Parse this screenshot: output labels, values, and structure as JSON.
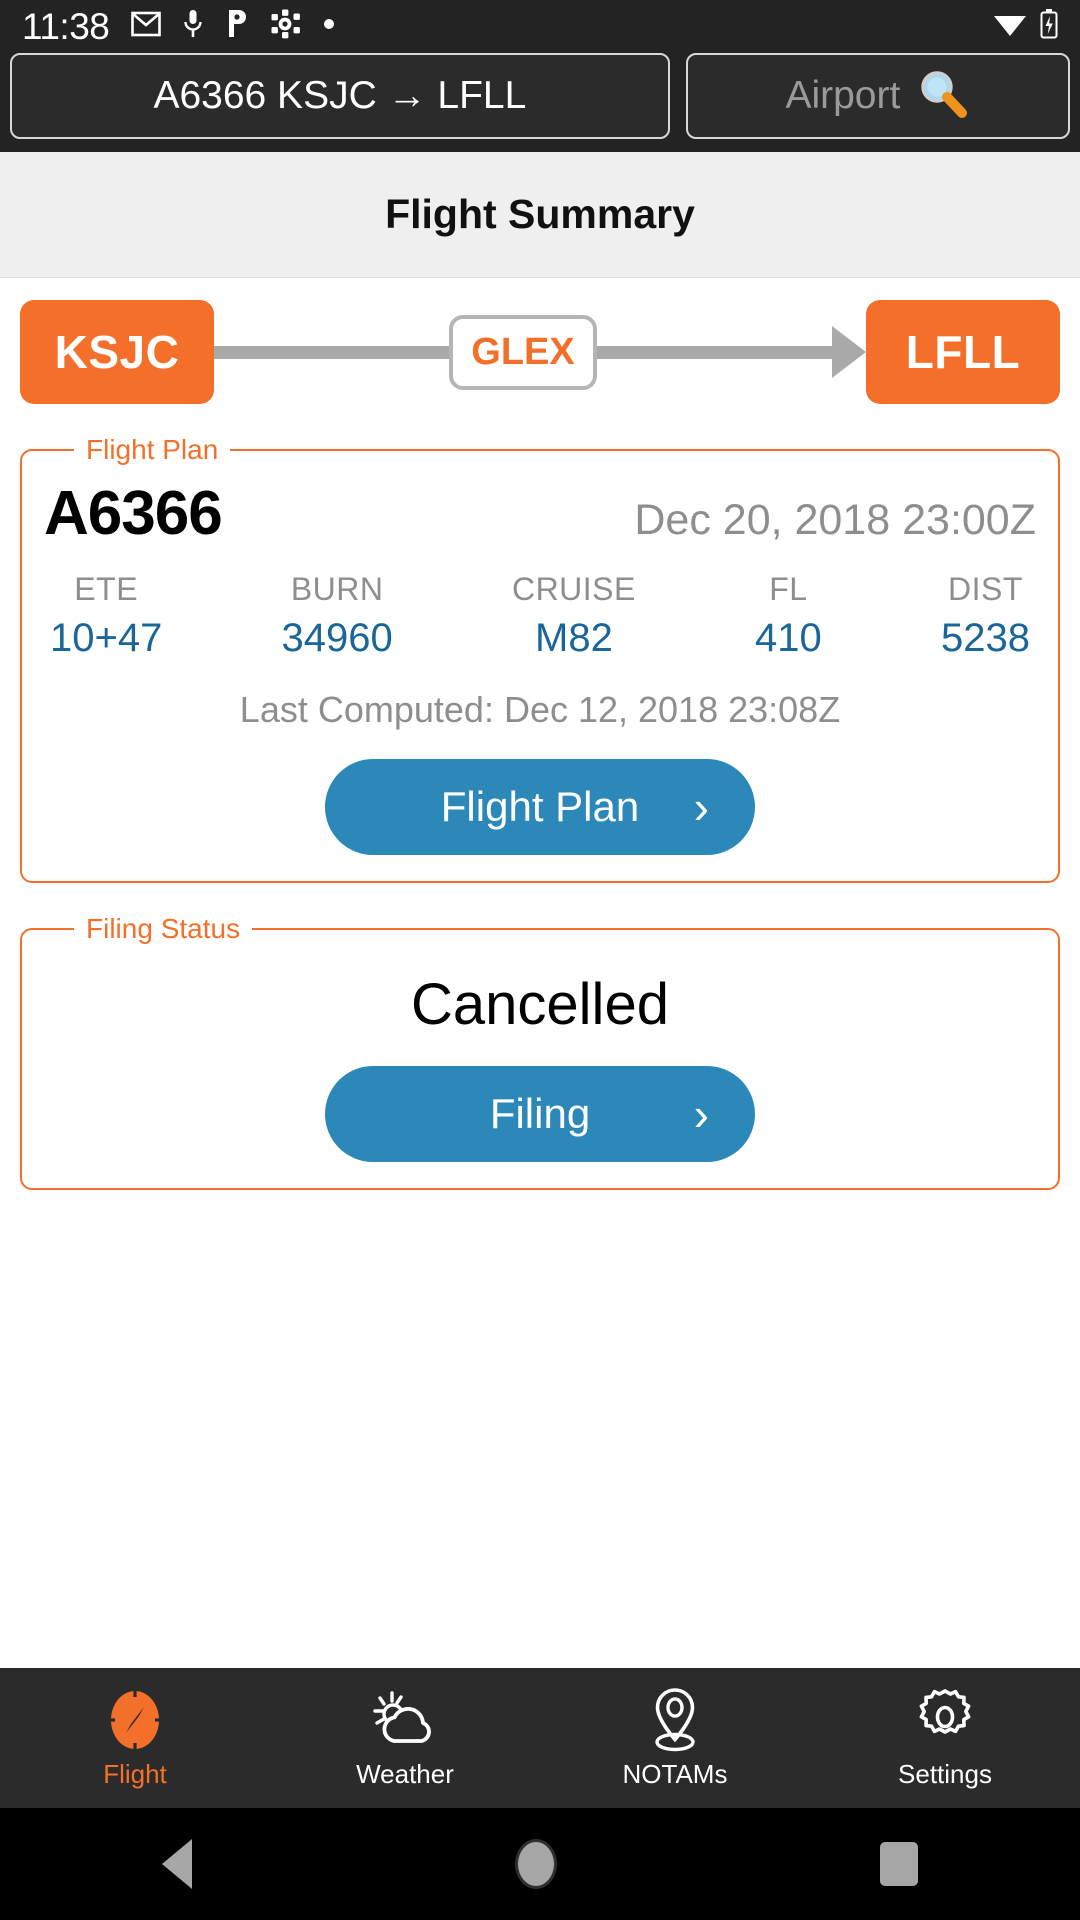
{
  "statusbar": {
    "clock": "11:38",
    "icons": [
      "gmail-icon",
      "microphone-icon",
      "pushbullet-icon",
      "settings-sync-icon",
      "dot-icon"
    ],
    "right_icons": [
      "wifi-icon",
      "battery-charging-icon"
    ]
  },
  "topbar": {
    "flight_field_value": "A6366 KSJC → LFLL",
    "airport_field_placeholder": "Airport",
    "airport_search_icon": "magnifier-icon"
  },
  "header": {
    "title": "Flight Summary"
  },
  "route": {
    "origin": "KSJC",
    "aircraft": "GLEX",
    "destination": "LFLL"
  },
  "flight_plan": {
    "legend": "Flight Plan",
    "flight_id": "A6366",
    "departure_datetime": "Dec 20, 2018 23:00Z",
    "stats": [
      {
        "label": "ETE",
        "value": "10+47"
      },
      {
        "label": "BURN",
        "value": "34960"
      },
      {
        "label": "CRUISE",
        "value": "M82"
      },
      {
        "label": "FL",
        "value": "410"
      },
      {
        "label": "DIST",
        "value": "5238"
      }
    ],
    "last_computed": "Last Computed: Dec 12, 2018 23:08Z",
    "button_label": "Flight Plan",
    "button_chevron": "chevron-right-icon"
  },
  "filing_status": {
    "legend": "Filing Status",
    "status": "Cancelled",
    "button_label": "Filing",
    "button_chevron": "chevron-right-icon"
  },
  "tabbar": {
    "tabs": [
      {
        "label": "Flight",
        "icon": "compass-icon",
        "active": true
      },
      {
        "label": "Weather",
        "icon": "sun-cloud-icon",
        "active": false
      },
      {
        "label": "NOTAMs",
        "icon": "map-pin-icon",
        "active": false
      },
      {
        "label": "Settings",
        "icon": "gear-icon",
        "active": false
      }
    ]
  },
  "navbar": {
    "back": "back-triangle-icon",
    "home": "home-circle-icon",
    "recents": "recents-square-icon"
  },
  "colors": {
    "accent_orange": "#f4702a",
    "button_blue": "#2b88b8",
    "value_blue": "#1a6699",
    "dark_chrome": "#2b2b2b"
  }
}
